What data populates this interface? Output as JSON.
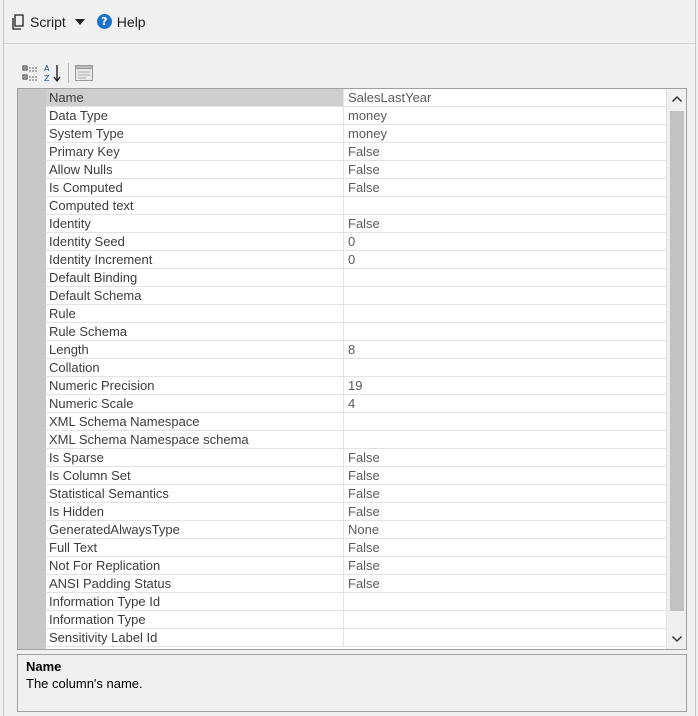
{
  "toolbar": {
    "script_label": "Script",
    "help_label": "Help"
  },
  "properties": [
    {
      "name": "Name",
      "value": "SalesLastYear"
    },
    {
      "name": "Data Type",
      "value": "money"
    },
    {
      "name": "System Type",
      "value": "money"
    },
    {
      "name": "Primary Key",
      "value": "False"
    },
    {
      "name": "Allow Nulls",
      "value": "False"
    },
    {
      "name": "Is Computed",
      "value": "False"
    },
    {
      "name": "Computed text",
      "value": ""
    },
    {
      "name": "Identity",
      "value": "False"
    },
    {
      "name": "Identity Seed",
      "value": "0"
    },
    {
      "name": "Identity Increment",
      "value": "0"
    },
    {
      "name": "Default Binding",
      "value": ""
    },
    {
      "name": "Default Schema",
      "value": ""
    },
    {
      "name": "Rule",
      "value": ""
    },
    {
      "name": "Rule Schema",
      "value": ""
    },
    {
      "name": "Length",
      "value": "8"
    },
    {
      "name": "Collation",
      "value": ""
    },
    {
      "name": "Numeric Precision",
      "value": "19"
    },
    {
      "name": "Numeric Scale",
      "value": "4"
    },
    {
      "name": "XML Schema Namespace",
      "value": ""
    },
    {
      "name": "XML Schema Namespace schema",
      "value": ""
    },
    {
      "name": "Is Sparse",
      "value": "False"
    },
    {
      "name": "Is Column Set",
      "value": "False"
    },
    {
      "name": "Statistical Semantics",
      "value": "False"
    },
    {
      "name": "Is Hidden",
      "value": "False"
    },
    {
      "name": "GeneratedAlwaysType",
      "value": "None"
    },
    {
      "name": "Full Text",
      "value": "False"
    },
    {
      "name": "Not For Replication",
      "value": "False"
    },
    {
      "name": "ANSI Padding Status",
      "value": "False"
    },
    {
      "name": "Information Type Id",
      "value": ""
    },
    {
      "name": "Information Type",
      "value": ""
    },
    {
      "name": "Sensitivity Label Id",
      "value": ""
    }
  ],
  "description": {
    "title": "Name",
    "text": "The column's name."
  },
  "colors": {
    "help_blue": "#1a73c9",
    "gutter": "#c8c8c8"
  }
}
